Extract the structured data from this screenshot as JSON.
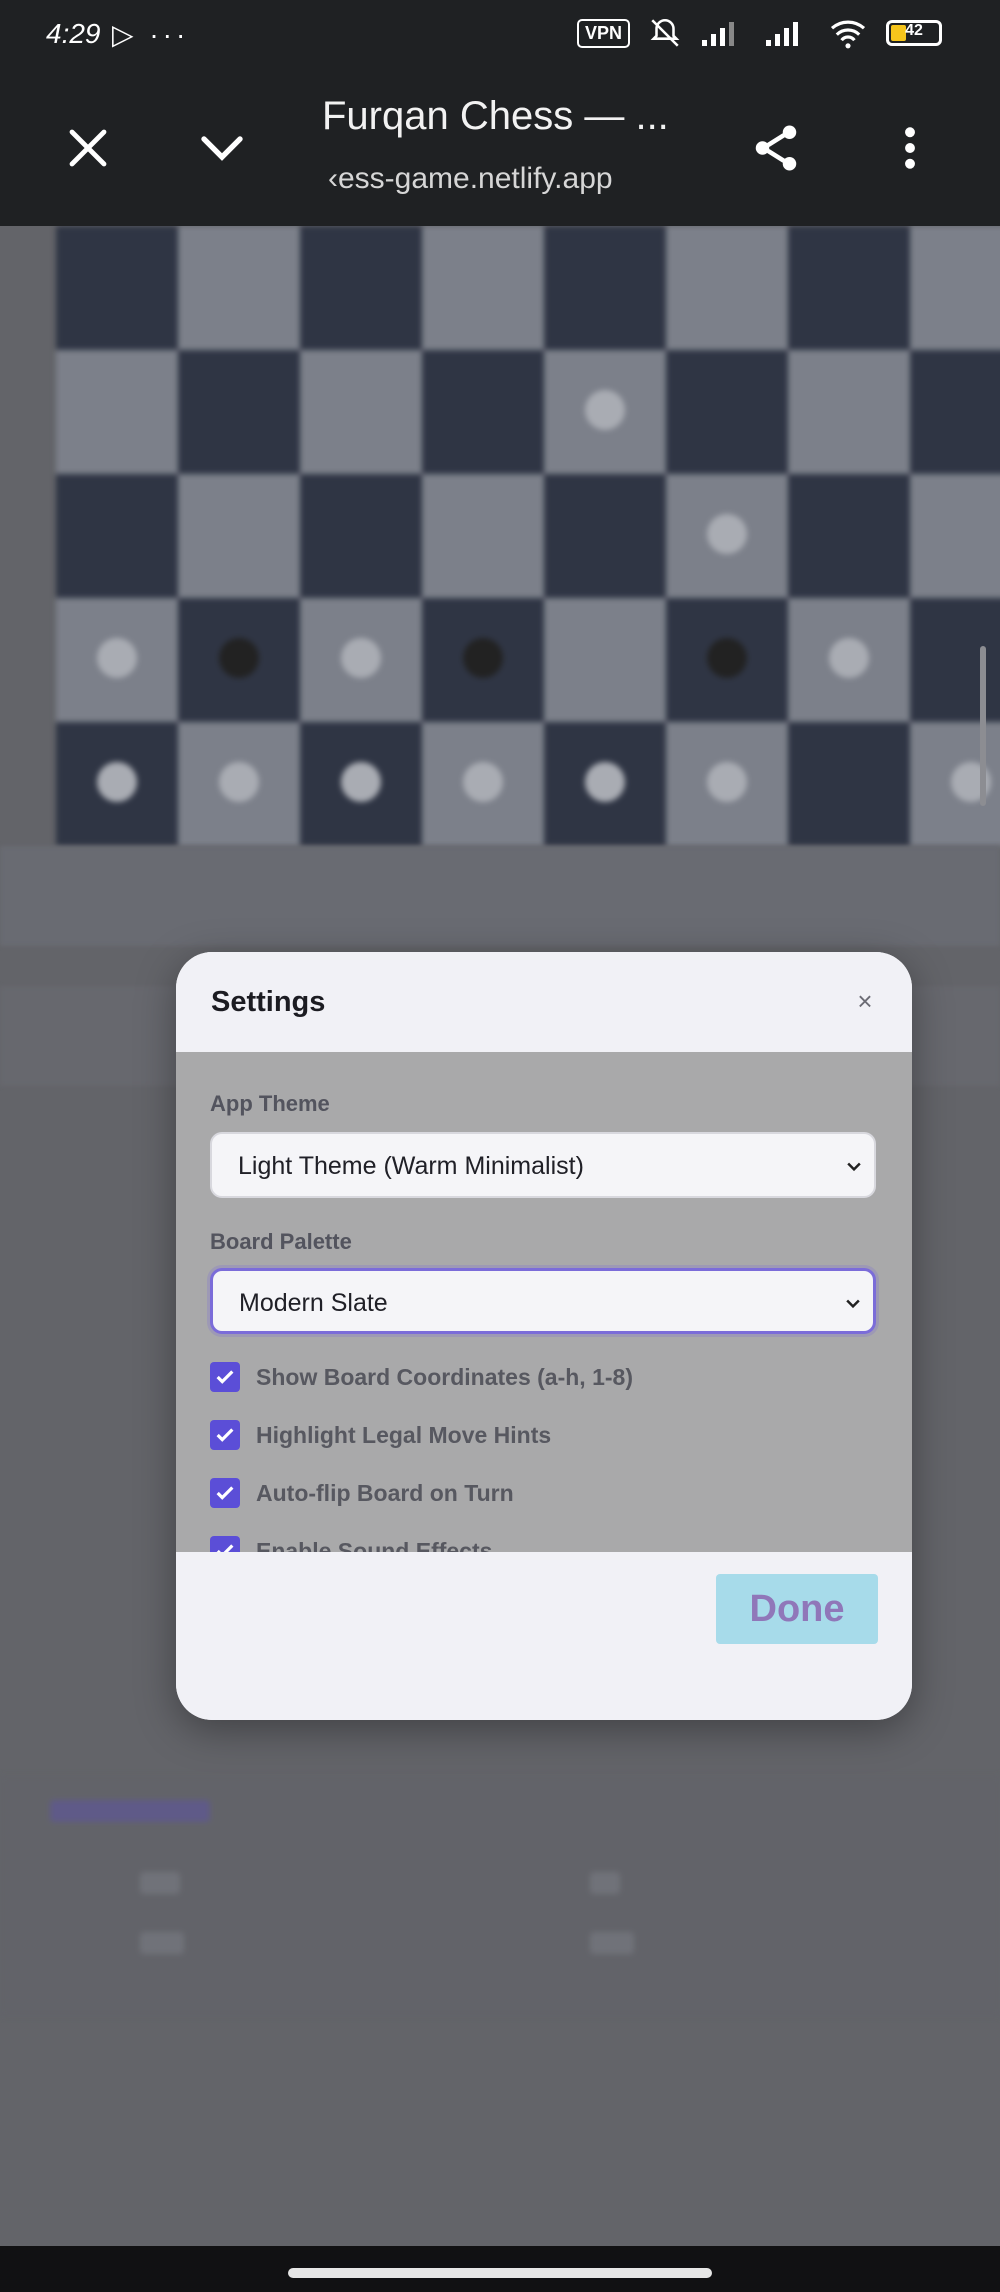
{
  "status_bar": {
    "time": "4:29",
    "left_icons": "▷ ···",
    "vpn_label": "VPN",
    "battery_level": "42"
  },
  "browser": {
    "page_title": "Furqan Chess — ...",
    "url": "‹ess-game.netlify.app",
    "icons": [
      "close-icon",
      "chevron-down-icon",
      "share-icon",
      "more-vert-icon"
    ]
  },
  "settings": {
    "title": "Settings",
    "close_glyph": "×",
    "app_theme": {
      "label": "App Theme",
      "selected": "Light Theme (Warm Minimalist)"
    },
    "board_palette": {
      "label": "Board Palette",
      "selected": "Modern Slate"
    },
    "options": [
      {
        "label": "Show Board Coordinates (a-h, 1-8)",
        "checked": true
      },
      {
        "label": "Highlight Legal Move Hints",
        "checked": true
      },
      {
        "label": "Auto-flip Board on Turn",
        "checked": true
      },
      {
        "label": "Enable Sound Effects",
        "checked": true
      }
    ],
    "done_label": "Done"
  },
  "colors": {
    "accent": "#5b4ed7",
    "done_bg": "#a7dbea",
    "done_text": "#9077b9",
    "overlay": "#636366"
  }
}
